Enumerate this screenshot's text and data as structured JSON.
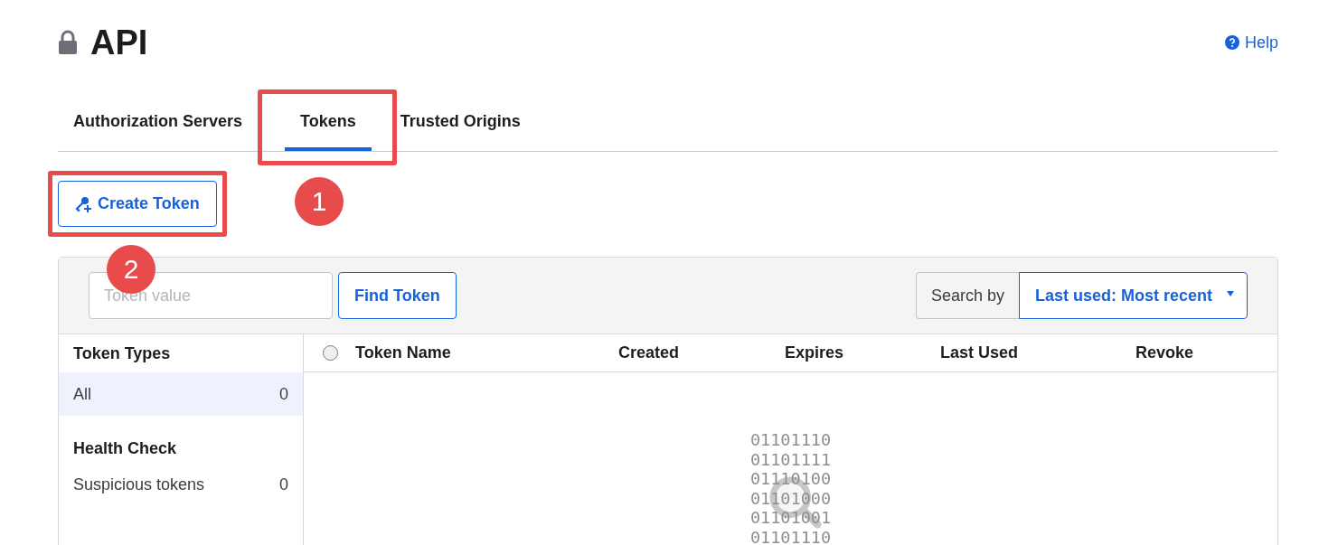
{
  "page": {
    "title": "API",
    "help": "Help"
  },
  "tabs": [
    {
      "label": "Authorization Servers",
      "selected": false
    },
    {
      "label": "Tokens",
      "selected": true,
      "callout": "1"
    }
  ],
  "tabs_rest": [
    {
      "label": "Trusted Origins",
      "selected": false
    }
  ],
  "create_button": {
    "label": "Create Token",
    "callout": "2"
  },
  "search": {
    "placeholder": "Token value",
    "find_button": "Find Token",
    "search_by_label": "Search by",
    "search_by_value": "Last used: Most recent"
  },
  "sidebar": [
    {
      "heading": "Token Types",
      "items": [
        {
          "label": "All",
          "count": "0",
          "selected": true
        }
      ]
    },
    {
      "heading": "Health Check",
      "items": [
        {
          "label": "Suspicious tokens",
          "count": "0",
          "selected": false
        }
      ]
    }
  ],
  "table": {
    "select_all_checked": false,
    "columns": [
      "Token Name",
      "Created",
      "Expires",
      "Last Used",
      "Revoke"
    ]
  },
  "empty_state": {
    "binary_lines": [
      "01101110",
      "01101111",
      "01110100",
      "01101000",
      "01101001",
      "01101110"
    ]
  }
}
